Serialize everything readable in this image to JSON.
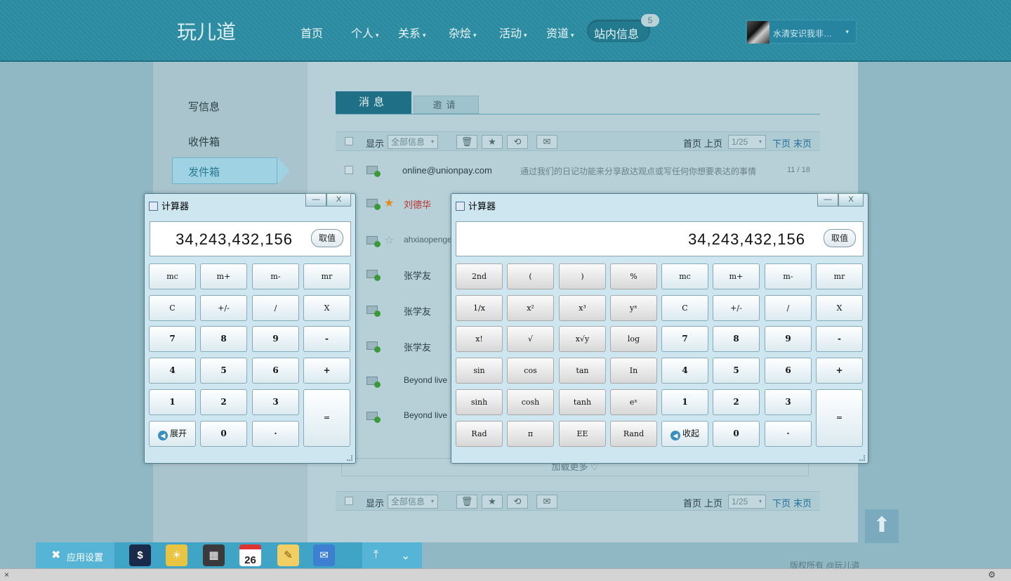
{
  "header": {
    "logo": "玩儿道",
    "nav": [
      {
        "label": "首页",
        "caret": ""
      },
      {
        "label": "个人",
        "caret": "▾"
      },
      {
        "label": "关系",
        "caret": "▾"
      },
      {
        "label": "杂烩",
        "caret": "▾"
      },
      {
        "label": "活动",
        "caret": "▾"
      },
      {
        "label": "资道",
        "caret": "▾"
      }
    ],
    "messages_label": "站内信息",
    "messages_badge": "5",
    "user_name": "水清安识我非…",
    "user_caret": "▾"
  },
  "sidebar": {
    "items": [
      "写信息",
      "收件箱",
      "发件箱"
    ],
    "active_index": 2
  },
  "tabs": {
    "active": "消息",
    "inactive": "邀请"
  },
  "toolbar": {
    "show_label": "显示",
    "filter_value": "全部信息",
    "filter_caret": "▾",
    "delete_icon": "🗑",
    "star_icon": "★",
    "refresh_icon": "⟲",
    "mail_icon": "✉",
    "first_page": "首页",
    "prev_page": "上页",
    "page_value": "1/25",
    "next_page": "下页",
    "last_page": "末页"
  },
  "messages": [
    {
      "sender": "online@unionpay.com",
      "preview": "通过我们的日记功能来分享敌达观点或写任何你想要表达的事情",
      "count": "11 / 18"
    },
    {
      "sender": "刘德华"
    },
    {
      "sender": "ahxiaopenge"
    },
    {
      "sender": "张学友"
    },
    {
      "sender": "张学友"
    },
    {
      "sender": "张学友"
    },
    {
      "sender": "Beyond live"
    },
    {
      "sender": "Beyond live"
    }
  ],
  "load_more": "加载更多 ♡",
  "footer": "版权所有 @玩儿道",
  "dock": {
    "settings_label": "应用设置",
    "calendar_day": "26",
    "colors": {
      "bar": "#3fa4c6",
      "accent": "#56b5d6"
    }
  },
  "calc_small": {
    "title": "计算器",
    "display": "34,243,432,156",
    "store_label": "取值",
    "expand_label": "展开"
  },
  "calc_large": {
    "title": "计算器",
    "display": "34,243,432,156",
    "store_label": "取值",
    "collapse_label": "收起"
  },
  "calc_keys": {
    "mc": "mc",
    "mplus": "m+",
    "mminus": "m-",
    "mr": "mr",
    "c": "C",
    "neg": "+/-",
    "div": "/",
    "mul": "X",
    "k7": "7",
    "k8": "8",
    "k9": "9",
    "sub": "-",
    "k4": "4",
    "k5": "5",
    "k6": "6",
    "add": "+",
    "k1": "1",
    "k2": "2",
    "k3": "3",
    "eq": "=",
    "k0": "0",
    "dot": "·"
  },
  "sci_keys": [
    [
      "2nd",
      "(",
      ")",
      "%"
    ],
    [
      "1/x",
      "x²",
      "x³",
      "yˣ"
    ],
    [
      "x!",
      "√",
      "x√y",
      "log"
    ],
    [
      "sin",
      "cos",
      "tan",
      "In"
    ],
    [
      "sinh",
      "cosh",
      "tanh",
      "eˣ"
    ],
    [
      "Rad",
      "π",
      "EE",
      "Rand"
    ]
  ],
  "window_buttons": {
    "minimize": "—",
    "close": "X"
  }
}
